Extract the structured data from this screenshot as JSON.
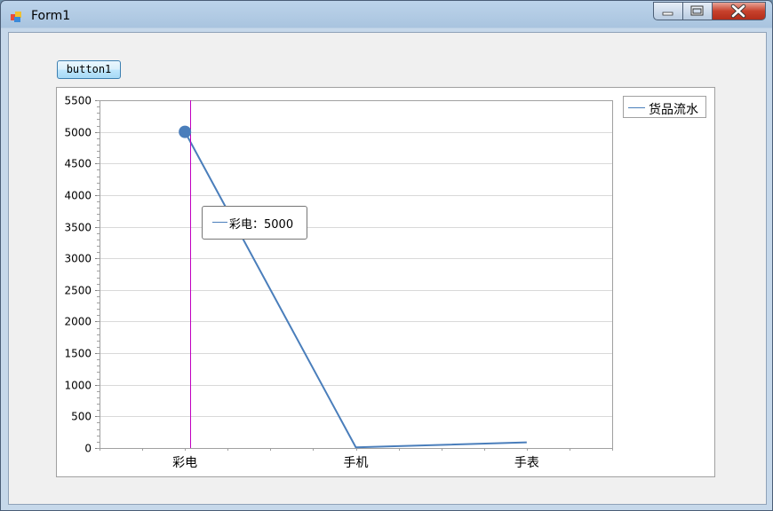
{
  "window": {
    "title": "Form1",
    "colors": {
      "close": "#c7412c",
      "frame": "#a9c4df"
    }
  },
  "form": {
    "button1_label": "button1"
  },
  "tooltip": {
    "label": "彩电：5000"
  },
  "chart_data": {
    "type": "line",
    "categories": [
      "彩电",
      "手机",
      "手表"
    ],
    "series": [
      {
        "name": "货品流水",
        "values": [
          5000,
          10,
          90
        ],
        "color": "#4a7ebb"
      }
    ],
    "ylim": [
      0,
      5500
    ],
    "yticks": [
      0,
      500,
      1000,
      1500,
      2000,
      2500,
      3000,
      3500,
      4000,
      4500,
      5000,
      5500
    ],
    "grid": true,
    "legend": "top-right",
    "highlighted_category": "彩电",
    "crosshair_color": "#c000c0"
  }
}
